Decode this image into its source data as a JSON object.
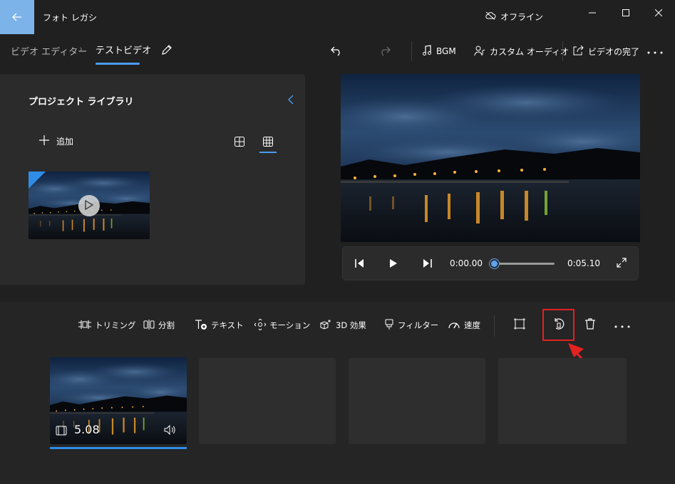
{
  "app": {
    "title": "フォト レガシ",
    "offline_label": "オフライン"
  },
  "breadcrumb": {
    "root": "ビデオ エディター",
    "separator": "›",
    "current": "テストビデオ"
  },
  "toolbar": {
    "bgm_label": "BGM",
    "custom_audio_label": "カスタム オーディオ",
    "finish_label": "ビデオの完了"
  },
  "library": {
    "title": "プロジェクト ライブラリ",
    "add_label": "追加"
  },
  "player": {
    "current_time": "0:00.00",
    "total_time": "0:05.10",
    "progress": 0
  },
  "tools": {
    "trim": "トリミング",
    "split": "分割",
    "text": "テキスト",
    "motion": "モーション",
    "effects_3d": "3D 効果",
    "filters": "フィルター",
    "speed": "速度"
  },
  "storyboard": {
    "clip_duration": "5.08"
  },
  "colors": {
    "accent": "#2f8ce8",
    "highlight": "#e32222",
    "background": "#202020",
    "panel": "#2b2b2b"
  }
}
